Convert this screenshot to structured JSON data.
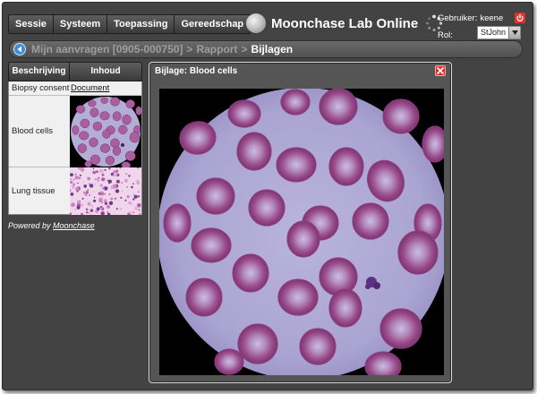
{
  "menu": {
    "items": [
      {
        "label": "Sessie"
      },
      {
        "label": "Systeem"
      },
      {
        "label": "Toepassing"
      },
      {
        "label": "Gereedschap"
      }
    ]
  },
  "brand": {
    "title": "Moonchase Lab Online"
  },
  "user": {
    "user_label": "Gebruiker:",
    "user_name": "keene",
    "role_label": "Rol:",
    "role_value": "StJohn"
  },
  "breadcrumb": {
    "link": "Mijn aanvragen [0905-000750]",
    "separator": ">",
    "middle": "Rapport",
    "current": "Bijlagen"
  },
  "attachments": {
    "tabs": {
      "description": "Beschrijving",
      "content": "Inhoud"
    },
    "rows": [
      {
        "label": "Biopsy consent",
        "content": "Document"
      },
      {
        "label": "Blood cells"
      },
      {
        "label": "Lung tissue"
      }
    ]
  },
  "footer": {
    "powered_prefix": "Powered by",
    "powered_link": "Moonchase"
  },
  "viewer": {
    "title": "Bijlage: Blood cells"
  },
  "colors": {
    "accent_blue": "#3e8ed6",
    "close_red": "#e0322d",
    "frame_bg": "#434343"
  },
  "icons": {
    "back": "back-arrow-icon",
    "power": "power-icon",
    "close": "close-icon",
    "spinner": "loading-spinner-icon",
    "logo": "moon-logo-icon",
    "dropdown": "chevron-down-icon"
  }
}
